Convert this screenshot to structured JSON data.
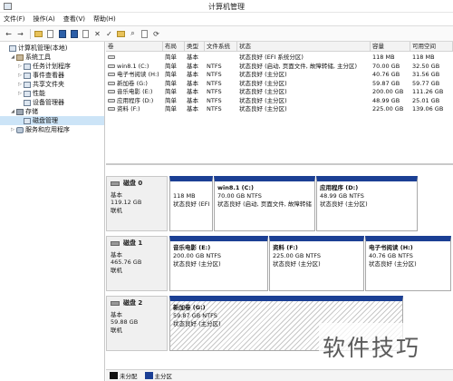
{
  "window": {
    "title": "计算机管理"
  },
  "menu": [
    "文件(F)",
    "操作(A)",
    "查看(V)",
    "帮助(H)"
  ],
  "tree": [
    {
      "label": "计算机管理(本地)",
      "indent": 0,
      "arrow": "",
      "icon": "computer-icon"
    },
    {
      "label": "系统工具",
      "indent": 1,
      "arrow": "◢",
      "icon": "tools-icon"
    },
    {
      "label": "任务计划程序",
      "indent": 2,
      "arrow": "▷",
      "icon": "clock-icon"
    },
    {
      "label": "事件查看器",
      "indent": 2,
      "arrow": "▷",
      "icon": "event-viewer-icon"
    },
    {
      "label": "共享文件夹",
      "indent": 2,
      "arrow": "▷",
      "icon": "shared-folder-icon"
    },
    {
      "label": "性能",
      "indent": 2,
      "arrow": "▷",
      "icon": "performance-icon"
    },
    {
      "label": "设备管理器",
      "indent": 2,
      "arrow": "",
      "icon": "device-manager-icon"
    },
    {
      "label": "存储",
      "indent": 1,
      "arrow": "◢",
      "icon": "storage-icon"
    },
    {
      "label": "磁盘管理",
      "indent": 2,
      "arrow": "",
      "icon": "disk-management-icon",
      "selected": true
    },
    {
      "label": "服务和应用程序",
      "indent": 1,
      "arrow": "▷",
      "icon": "services-icon"
    }
  ],
  "list": {
    "columns": [
      "卷",
      "布局",
      "类型",
      "文件系统",
      "状态",
      "容量",
      "可用空间"
    ],
    "rows": [
      [
        "",
        "简单",
        "基本",
        "",
        "状态良好 (EFI 系统分区)",
        "118 MB",
        "118 MB"
      ],
      [
        "win8.1 (C:)",
        "简单",
        "基本",
        "NTFS",
        "状态良好 (启动, 页面文件, 故障转储, 主分区)",
        "70.00 GB",
        "32.50 GB"
      ],
      [
        "电子书阅读 (H:)",
        "简单",
        "基本",
        "NTFS",
        "状态良好 (主分区)",
        "40.76 GB",
        "31.56 GB"
      ],
      [
        "新加卷 (G:)",
        "简单",
        "基本",
        "NTFS",
        "状态良好 (主分区)",
        "59.87 GB",
        "59.77 GB"
      ],
      [
        "音乐电影 (E:)",
        "简单",
        "基本",
        "NTFS",
        "状态良好 (主分区)",
        "200.00 GB",
        "111.26 GB"
      ],
      [
        "应用程序 (D:)",
        "简单",
        "基本",
        "NTFS",
        "状态良好 (主分区)",
        "48.99 GB",
        "25.01 GB"
      ],
      [
        "资料 (F:)",
        "简单",
        "基本",
        "NTFS",
        "状态良好 (主分区)",
        "225.00 GB",
        "139.06 GB"
      ]
    ]
  },
  "disks": [
    {
      "name": "磁盘 0",
      "type": "基本",
      "size": "119.12 GB",
      "status": "联机",
      "partitions": [
        {
          "label": "",
          "size": "118 MB",
          "status": "状态良好 (EFI"
        },
        {
          "label": "win8.1 (C:)",
          "size": "70.00 GB NTFS",
          "status": "状态良好 (启动, 页面文件, 故障转储"
        },
        {
          "label": "应用程序 (D:)",
          "size": "48.99 GB NTFS",
          "status": "状态良好 (主分区)"
        }
      ]
    },
    {
      "name": "磁盘 1",
      "type": "基本",
      "size": "465.76 GB",
      "status": "联机",
      "partitions": [
        {
          "label": "音乐电影 (E:)",
          "size": "200.00 GB NTFS",
          "status": "状态良好 (主分区)"
        },
        {
          "label": "资料 (F:)",
          "size": "225.00 GB NTFS",
          "status": "状态良好 (主分区)"
        },
        {
          "label": "电子书阅读 (H:)",
          "size": "40.76 GB NTFS",
          "status": "状态良好 (主分区)"
        }
      ]
    },
    {
      "name": "磁盘 2",
      "type": "基本",
      "size": "59.88 GB",
      "status": "联机",
      "partitions": [
        {
          "label": "新加卷 (G:)",
          "size": "59.87 GB NTFS",
          "status": "状态良好 (主分区)"
        }
      ]
    }
  ],
  "legend": [
    {
      "label": "未分配",
      "color": "#111111"
    },
    {
      "label": "主分区",
      "color": "#1b3f94"
    }
  ],
  "watermark": "软件技巧",
  "colors": {
    "partition_bar": "#1b3f94",
    "selected_bg": "#cce4f7"
  }
}
